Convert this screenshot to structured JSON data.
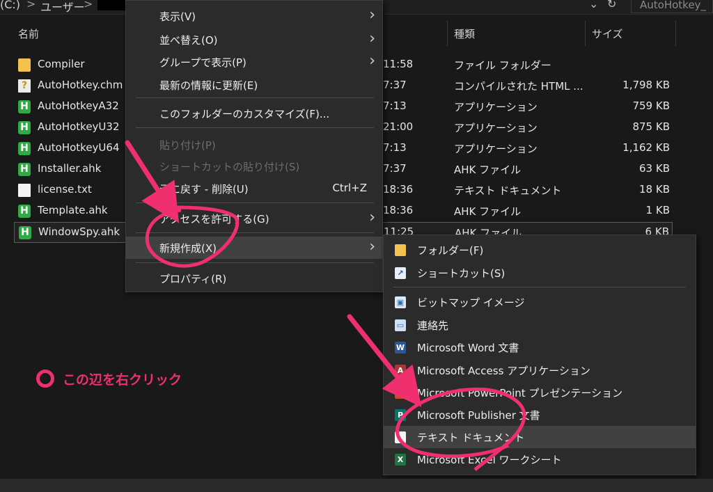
{
  "addressbar": {
    "drive": "(C:)",
    "users": "ユーザー",
    "hidden_path": "...",
    "search_placeholder": "AutoHotkey_"
  },
  "columns": {
    "name": "名前",
    "type": "種類",
    "size": "サイズ"
  },
  "files": [
    {
      "name": "Compiler",
      "time": "11:58",
      "type": "ファイル フォルダー",
      "size": "",
      "icon": "folder-icon"
    },
    {
      "name": "AutoHotkey.chm",
      "time": "7:37",
      "type": "コンパイルされた HTML ...",
      "size": "1,798 KB",
      "icon": "help-file-icon"
    },
    {
      "name": "AutoHotkeyA32",
      "time": "7:13",
      "type": "アプリケーション",
      "size": "759 KB",
      "icon": "ahk-app-icon"
    },
    {
      "name": "AutoHotkeyU32",
      "time": "21:00",
      "type": "アプリケーション",
      "size": "875 KB",
      "icon": "ahk-app-icon"
    },
    {
      "name": "AutoHotkeyU64",
      "time": "7:13",
      "type": "アプリケーション",
      "size": "1,162 KB",
      "icon": "ahk-app-icon"
    },
    {
      "name": "Installer.ahk",
      "time": "7:37",
      "type": "AHK ファイル",
      "size": "63 KB",
      "icon": "ahk-script-icon"
    },
    {
      "name": "license.txt",
      "time": "18:36",
      "type": "テキスト ドキュメント",
      "size": "18 KB",
      "icon": "text-file-icon"
    },
    {
      "name": "Template.ahk",
      "time": "18:36",
      "type": "AHK ファイル",
      "size": "1 KB",
      "icon": "ahk-script-icon"
    },
    {
      "name": "WindowSpy.ahk",
      "time": "11:25",
      "type": "AHK ファイル",
      "size": "6 KB",
      "icon": "ahk-script-icon"
    }
  ],
  "context_menu": {
    "view": "表示(V)",
    "sort": "並べ替え(O)",
    "group": "グループで表示(P)",
    "refresh": "最新の情報に更新(E)",
    "customize": "このフォルダーのカスタマイズ(F)...",
    "paste": "貼り付け(P)",
    "paste_shortcut": "ショートカットの貼り付け(S)",
    "undo": "元に戻す - 削除(U)",
    "undo_shortcut": "Ctrl+Z",
    "give_access": "アクセスを許可する(G)",
    "new": "新規作成(X)",
    "properties": "プロパティ(R)"
  },
  "submenu": {
    "folder": "フォルダー(F)",
    "shortcut": "ショートカット(S)",
    "bitmap": "ビットマップ イメージ",
    "contact": "連絡先",
    "word": "Microsoft Word 文書",
    "access": "Microsoft Access アプリケーション",
    "powerpoint": "Microsoft PowerPoint プレゼンテーション",
    "publisher": "Microsoft Publisher 文書",
    "text": "テキスト ドキュメント",
    "excel": "Microsoft Excel ワークシート"
  },
  "annotation": {
    "text": "この辺を右クリック"
  },
  "colors": {
    "accent": "#f0306e",
    "background": "#191919",
    "menu": "#2b2b2b",
    "highlight": "#414141"
  }
}
